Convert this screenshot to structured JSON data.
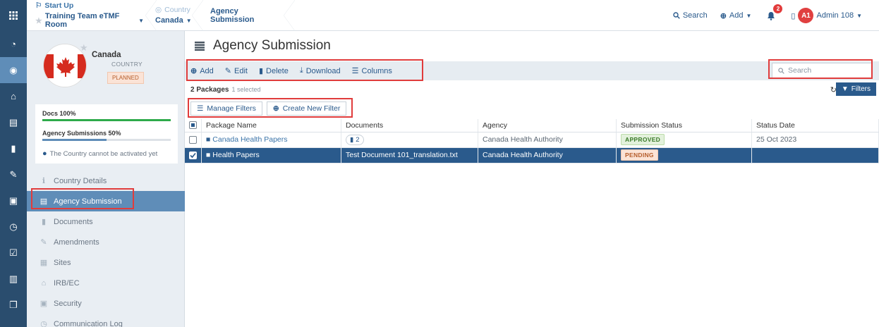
{
  "topbar": {
    "breadcrumbs": [
      {
        "top": "Start Up",
        "bottom": "Training Team eTMF Room"
      },
      {
        "top": "Country",
        "bottom": "Canada"
      },
      {
        "single": "Agency Submission"
      }
    ],
    "search_label": "Search",
    "add_label": "Add",
    "notification_count": "2",
    "avatar_initials": "A1",
    "user_name": "Admin 108"
  },
  "country": {
    "name": "Canada",
    "type": "COUNTRY",
    "status": "PLANNED",
    "docs_label": "Docs 100%",
    "docs_progress": 1.0,
    "agency_label": "Agency Submissions 50%",
    "agency_progress": 0.5,
    "warning": "The Country cannot be activated yet"
  },
  "side_menu": [
    {
      "label": "Country Details",
      "icon": "info-icon",
      "active": false
    },
    {
      "label": "Agency Submission",
      "icon": "list-icon",
      "active": true
    },
    {
      "label": "Documents",
      "icon": "document-icon",
      "active": false
    },
    {
      "label": "Amendments",
      "icon": "edit-icon",
      "active": false
    },
    {
      "label": "Sites",
      "icon": "building-icon",
      "active": false
    },
    {
      "label": "IRB/EC",
      "icon": "institution-icon",
      "active": false
    },
    {
      "label": "Security",
      "icon": "lock-icon",
      "active": false
    },
    {
      "label": "Communication Log",
      "icon": "clock-icon",
      "active": false
    }
  ],
  "main": {
    "title": "Agency Submission",
    "toolbar": {
      "add": "Add",
      "edit": "Edit",
      "delete": "Delete",
      "download": "Download",
      "columns": "Columns"
    },
    "search_placeholder": "Search",
    "package_count": "2 Packages",
    "selected_text": "1 selected",
    "filters_label": "Filters",
    "manage_filters": "Manage Filters",
    "create_filter": "Create New Filter",
    "columns": [
      "Package Name",
      "Documents",
      "Agency",
      "Submission Status",
      "Status Date"
    ],
    "rows": [
      {
        "name": "Canada Health Papers",
        "documents": "2",
        "agency": "Canada Health Authority",
        "status": "APPROVED",
        "date": "25 Oct 2023",
        "selected": false
      },
      {
        "name": "Health Papers",
        "documents": "Test Document 101_translation.txt",
        "agency": "Canada Health Authority",
        "status": "PENDING",
        "date": "",
        "selected": true
      }
    ]
  },
  "colors": {
    "nav_dark": "#2a4d6e",
    "accent": "#2a5a8c",
    "active_menu": "#5f8db8",
    "progress_green": "#2eaa4a",
    "progress_blue": "#5f8db8",
    "highlight_red": "#e03c3c"
  }
}
